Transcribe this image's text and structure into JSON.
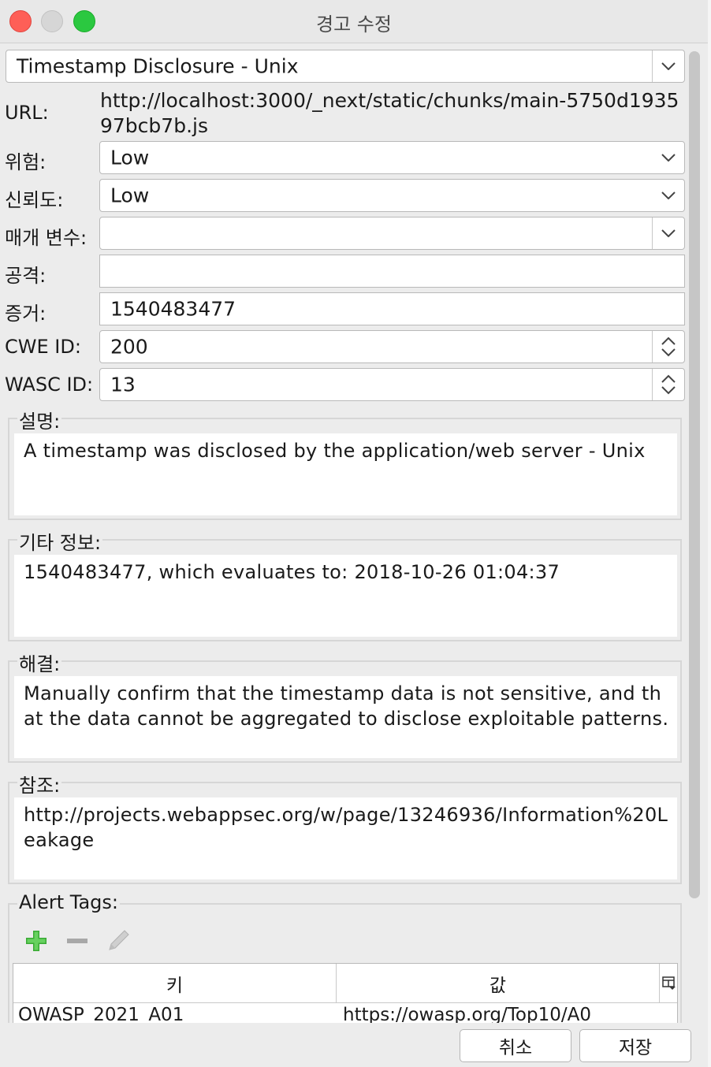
{
  "window": {
    "title": "경고 수정"
  },
  "alert_name": "Timestamp Disclosure - Unix",
  "fields": {
    "url_label": "URL:",
    "url_value": "http://localhost:3000/_next/static/chunks/main-5750d193597bcb7b.js",
    "risk_label": "위험:",
    "risk_value": "Low",
    "confidence_label": "신뢰도:",
    "confidence_value": "Low",
    "parameter_label": "매개 변수:",
    "parameter_value": "",
    "attack_label": "공격:",
    "attack_value": "",
    "evidence_label": "증거:",
    "evidence_value": "1540483477",
    "cwe_label": "CWE ID:",
    "cwe_value": "200",
    "wasc_label": "WASC ID:",
    "wasc_value": "13"
  },
  "sections": {
    "description_title": "설명:",
    "description_text": "A timestamp was disclosed by the application/web server - Unix",
    "otherinfo_title": "기타 정보:",
    "otherinfo_text": "1540483477, which evaluates to: 2018-10-26 01:04:37",
    "solution_title": "해결:",
    "solution_text": "Manually confirm that the timestamp data is not sensitive, and that the data cannot be aggregated to disclose exploitable patterns.",
    "reference_title": "참조:",
    "reference_text": "http://projects.webappsec.org/w/page/13246936/Information%20Leakage"
  },
  "tags": {
    "title": "Alert Tags:",
    "col_key": "키",
    "col_value": "값",
    "rows": [
      {
        "key": "OWASP_2021_A01",
        "value": "https://owasp.org/Top10/A0"
      }
    ]
  },
  "buttons": {
    "cancel": "취소",
    "save": "저장"
  },
  "colors": {
    "add": "#3aaa35",
    "remove": "#9a9a9a",
    "close": "#fe5f57",
    "maximize": "#2bc840"
  }
}
